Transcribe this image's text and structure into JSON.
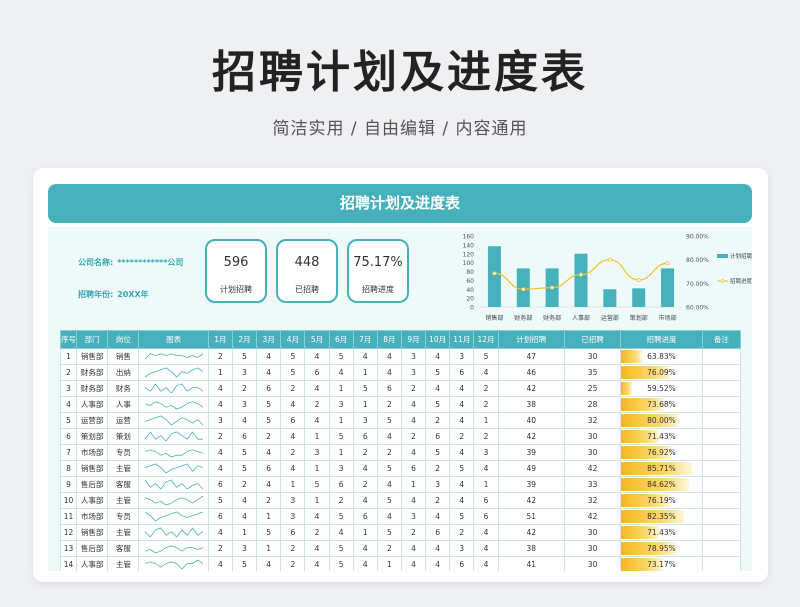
{
  "hero": {
    "title": "招聘计划及进度表",
    "subtitle": "简洁实用 / 自由编辑 / 内容通用"
  },
  "banner": {
    "title": "招聘计划及进度表"
  },
  "info": {
    "company_label": "公司名称:",
    "company_value": "************公司",
    "year_label": "招聘年份:",
    "year_value": "20XX年"
  },
  "kpis": [
    {
      "value": "596",
      "label": "计划招聘"
    },
    {
      "value": "448",
      "label": "已招聘"
    },
    {
      "value": "75.17%",
      "label": "招聘进度"
    }
  ],
  "colors": {
    "accent": "#46b0bb",
    "line": "#f2c12e",
    "bar_fill": "#f6b81e"
  },
  "chart_data": {
    "type": "bar",
    "categories": [
      "销售部",
      "财务部",
      "财务部",
      "人事部",
      "运营部",
      "策划部",
      "市场部"
    ],
    "series": [
      {
        "name": "计划招聘",
        "type": "bar",
        "axis": "left",
        "values": [
          137,
          87,
          87,
          120,
          40,
          42,
          87
        ]
      },
      {
        "name": "招聘进度",
        "type": "line",
        "axis": "right",
        "values": [
          0.742,
          0.675,
          0.682,
          0.737,
          0.8,
          0.714,
          0.785
        ]
      }
    ],
    "ylim": [
      0,
      160
    ],
    "yticks": [
      "0",
      "20",
      "40",
      "60",
      "80",
      "100",
      "120",
      "140",
      "160"
    ],
    "y2lim": [
      0.6,
      0.9
    ],
    "y2ticks": [
      "60.00%",
      "70.00%",
      "80.00%",
      "90.00%"
    ],
    "legend_position": "right"
  },
  "table": {
    "headers": [
      "序号",
      "部门",
      "岗位",
      "图表",
      "1月",
      "2月",
      "3月",
      "4月",
      "5月",
      "6月",
      "7月",
      "8月",
      "9月",
      "10月",
      "11月",
      "12月",
      "计划招聘",
      "已招聘",
      "招聘进度",
      "备注"
    ],
    "rows": [
      {
        "no": "1",
        "dept": "销售部",
        "pos": "销售",
        "months": [
          "2",
          "5",
          "4",
          "5",
          "4",
          "5",
          "4",
          "4",
          "3",
          "4",
          "3",
          "5"
        ],
        "plan": "47",
        "done": "30",
        "progress": "63.83%",
        "note": ""
      },
      {
        "no": "2",
        "dept": "财务部",
        "pos": "出纳",
        "months": [
          "1",
          "3",
          "4",
          "5",
          "6",
          "4",
          "1",
          "4",
          "3",
          "5",
          "6",
          "4"
        ],
        "plan": "46",
        "done": "35",
        "progress": "76.09%",
        "note": ""
      },
      {
        "no": "3",
        "dept": "财务部",
        "pos": "财务",
        "months": [
          "4",
          "2",
          "6",
          "2",
          "4",
          "1",
          "5",
          "6",
          "2",
          "4",
          "4",
          "2"
        ],
        "plan": "42",
        "done": "25",
        "progress": "59.52%",
        "note": ""
      },
      {
        "no": "4",
        "dept": "人事部",
        "pos": "人事",
        "months": [
          "4",
          "3",
          "5",
          "4",
          "2",
          "3",
          "1",
          "2",
          "4",
          "5",
          "4",
          "2"
        ],
        "plan": "38",
        "done": "28",
        "progress": "73.68%",
        "note": ""
      },
      {
        "no": "5",
        "dept": "运营部",
        "pos": "运营",
        "months": [
          "3",
          "4",
          "5",
          "6",
          "4",
          "1",
          "3",
          "5",
          "4",
          "2",
          "4",
          "1"
        ],
        "plan": "40",
        "done": "32",
        "progress": "80.00%",
        "note": ""
      },
      {
        "no": "6",
        "dept": "策划部",
        "pos": "策划",
        "months": [
          "2",
          "6",
          "2",
          "4",
          "1",
          "5",
          "6",
          "4",
          "2",
          "6",
          "2",
          "2"
        ],
        "plan": "42",
        "done": "30",
        "progress": "71.43%",
        "note": ""
      },
      {
        "no": "7",
        "dept": "市场部",
        "pos": "专员",
        "months": [
          "4",
          "5",
          "4",
          "2",
          "3",
          "1",
          "2",
          "2",
          "4",
          "5",
          "4",
          "3"
        ],
        "plan": "39",
        "done": "30",
        "progress": "76.92%",
        "note": ""
      },
      {
        "no": "8",
        "dept": "销售部",
        "pos": "主管",
        "months": [
          "4",
          "5",
          "6",
          "4",
          "1",
          "3",
          "4",
          "5",
          "6",
          "2",
          "5",
          "4"
        ],
        "plan": "49",
        "done": "42",
        "progress": "85.71%",
        "note": ""
      },
      {
        "no": "9",
        "dept": "售后部",
        "pos": "客服",
        "months": [
          "6",
          "2",
          "4",
          "1",
          "5",
          "6",
          "2",
          "4",
          "1",
          "3",
          "4",
          "1"
        ],
        "plan": "39",
        "done": "33",
        "progress": "84.62%",
        "note": ""
      },
      {
        "no": "10",
        "dept": "人事部",
        "pos": "主管",
        "months": [
          "5",
          "4",
          "2",
          "3",
          "1",
          "2",
          "4",
          "5",
          "4",
          "2",
          "4",
          "6"
        ],
        "plan": "42",
        "done": "32",
        "progress": "76.19%",
        "note": ""
      },
      {
        "no": "11",
        "dept": "市场部",
        "pos": "专员",
        "months": [
          "6",
          "4",
          "1",
          "3",
          "4",
          "5",
          "6",
          "4",
          "3",
          "4",
          "5",
          "6"
        ],
        "plan": "51",
        "done": "42",
        "progress": "82.35%",
        "note": ""
      },
      {
        "no": "12",
        "dept": "销售部",
        "pos": "主管",
        "months": [
          "4",
          "1",
          "5",
          "6",
          "2",
          "4",
          "1",
          "5",
          "2",
          "6",
          "2",
          "4"
        ],
        "plan": "42",
        "done": "30",
        "progress": "71.43%",
        "note": ""
      },
      {
        "no": "13",
        "dept": "售后部",
        "pos": "客服",
        "months": [
          "2",
          "3",
          "1",
          "2",
          "4",
          "5",
          "4",
          "2",
          "4",
          "4",
          "3",
          "4"
        ],
        "plan": "38",
        "done": "30",
        "progress": "78.95%",
        "note": ""
      },
      {
        "no": "14",
        "dept": "人事部",
        "pos": "主管",
        "months": [
          "4",
          "5",
          "4",
          "2",
          "4",
          "5",
          "4",
          "1",
          "4",
          "4",
          "6",
          "4"
        ],
        "plan": "41",
        "done": "30",
        "progress": "73.17%",
        "note": ""
      }
    ]
  }
}
